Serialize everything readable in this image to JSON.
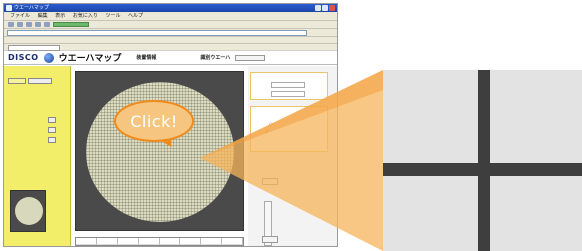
{
  "browser": {
    "window_title": "ウエーハマップ",
    "menu_items": [
      "ファイル",
      "編集",
      "表示",
      "お気に入り",
      "ツール",
      "ヘルプ"
    ],
    "address": "",
    "tab_label": ""
  },
  "app": {
    "logo_text": "DISCO",
    "title": "ウエーハマップ",
    "header_label_1": "装置情報",
    "header_value_1": "",
    "header_label_2": "識別ウエーハ"
  },
  "right_panel": {
    "field_1_value": "",
    "field_2_value": "",
    "unit": ""
  },
  "callout": {
    "text": "Click!"
  },
  "colors": {
    "accent_orange": "#f08a1a",
    "callout_fill": "#f6c680",
    "side_panel_yellow": "#f3ee6a",
    "wafer_fill": "#dcdcc0",
    "zoom_bg": "#e3e3e3",
    "zoom_line": "#3e3e3e"
  }
}
